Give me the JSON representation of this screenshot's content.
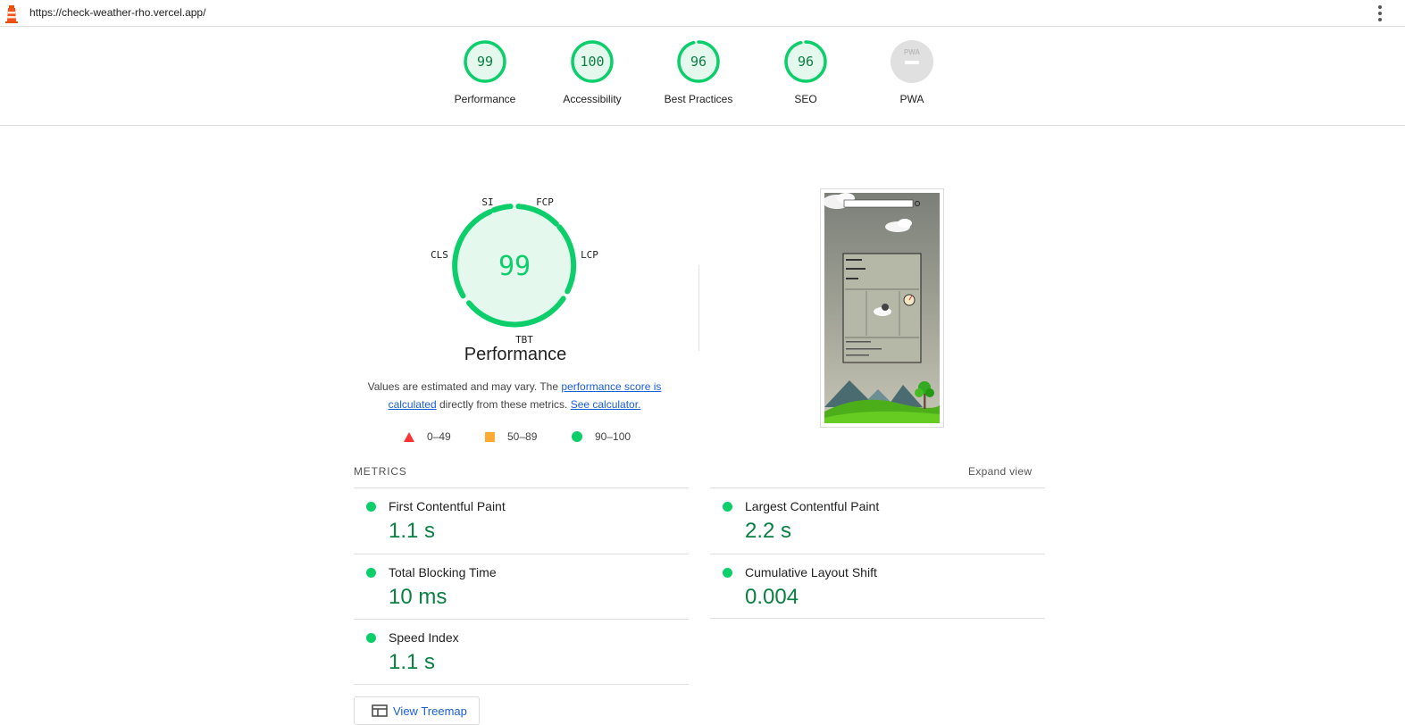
{
  "browser": {
    "url": "https://check-weather-rho.vercel.app/"
  },
  "scores": [
    {
      "label": "Performance",
      "value": "99",
      "fraction": 0.99
    },
    {
      "label": "Accessibility",
      "value": "100",
      "fraction": 1.0
    },
    {
      "label": "Best Practices",
      "value": "96",
      "fraction": 0.96
    },
    {
      "label": "SEO",
      "value": "96",
      "fraction": 0.96
    },
    {
      "label": "PWA",
      "value": "PWA"
    }
  ],
  "performance": {
    "score": "99",
    "title": "Performance",
    "segment_labels": {
      "si": "SI",
      "fcp": "FCP",
      "lcp": "LCP",
      "tbt": "TBT",
      "cls": "CLS"
    },
    "desc_prefix": "Values are estimated and may vary. The ",
    "desc_link1": "performance score is calculated",
    "desc_mid": " directly from these metrics. ",
    "desc_link2": "See calculator."
  },
  "legend": [
    {
      "range": "0–49",
      "shape": "triangle",
      "color": "#ff3333"
    },
    {
      "range": "50–89",
      "shape": "square",
      "color": "#ffaa33"
    },
    {
      "range": "90–100",
      "shape": "circle",
      "color": "#0cce6b"
    }
  ],
  "metrics": {
    "title": "METRICS",
    "expand_label": "Expand view",
    "items": [
      {
        "name": "First Contentful Paint",
        "value": "1.1 s"
      },
      {
        "name": "Largest Contentful Paint",
        "value": "2.2 s"
      },
      {
        "name": "Total Blocking Time",
        "value": "10 ms"
      },
      {
        "name": "Cumulative Layout Shift",
        "value": "0.004"
      },
      {
        "name": "Speed Index",
        "value": "1.1 s"
      }
    ]
  },
  "treemap": {
    "label": "View Treemap"
  },
  "colors": {
    "pass": "#0cce6b",
    "pass_text": "#0b8043",
    "pass_bg": "#e5f8ee",
    "link": "#1a5fd6"
  }
}
